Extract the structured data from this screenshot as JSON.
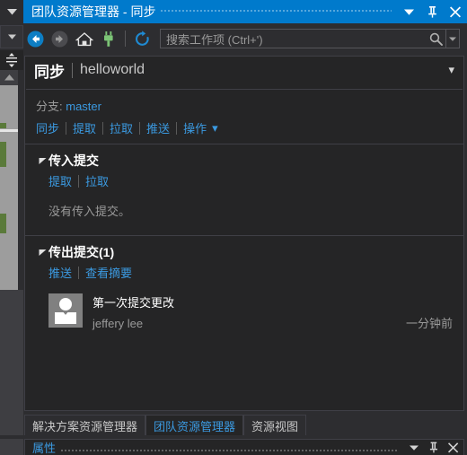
{
  "window": {
    "title": "团队资源管理器 - 同步",
    "buttons": {
      "dropdown": "window-dropdown",
      "pin": "window-pin",
      "close": "window-close"
    }
  },
  "toolbar": {
    "back": "back-icon",
    "forward": "forward-icon",
    "home": "home-icon",
    "connect": "plug-icon",
    "refresh": "refresh-icon",
    "search": {
      "placeholder": "搜索工作项 (Ctrl+')",
      "value": "",
      "icon": "search-icon",
      "dropdown": "search-dropdown-icon"
    }
  },
  "header": {
    "title": "同步",
    "separator": "|",
    "project": "helloworld",
    "caret": "▾"
  },
  "branch": {
    "label": "分支:",
    "name": "master"
  },
  "actions": [
    {
      "label": "同步"
    },
    {
      "label": "提取"
    },
    {
      "label": "拉取"
    },
    {
      "label": "推送"
    },
    {
      "label": "操作"
    }
  ],
  "actions_caret": "▾",
  "incoming": {
    "triangle": "▾",
    "title": "传入提交",
    "links": [
      {
        "label": "提取"
      },
      {
        "label": "拉取"
      }
    ],
    "empty_text": "没有传入提交。"
  },
  "outgoing": {
    "triangle": "▾",
    "title": "传出提交(1)",
    "links": [
      {
        "label": "推送"
      },
      {
        "label": "查看摘要"
      }
    ],
    "commits": [
      {
        "message": "第一次提交更改",
        "author": "jeffery lee",
        "time": "一分钟前",
        "avatar": "user-avatar"
      }
    ]
  },
  "bottom_tabs": [
    {
      "label": "解决方案资源管理器",
      "active": false
    },
    {
      "label": "团队资源管理器",
      "active": true
    },
    {
      "label": "资源视图",
      "active": false
    }
  ],
  "properties_panel": {
    "title": "属性",
    "dropdown": "properties-dropdown",
    "pin": "properties-pin",
    "close": "properties-close"
  },
  "colors": {
    "accent": "#007acc",
    "link": "#3b9ae1",
    "panel_bg": "#252526",
    "chrome_bg": "#2d2d30",
    "border": "#3f3f46",
    "muted_text": "#9a9a9a",
    "connect_green": "#7cc576"
  }
}
